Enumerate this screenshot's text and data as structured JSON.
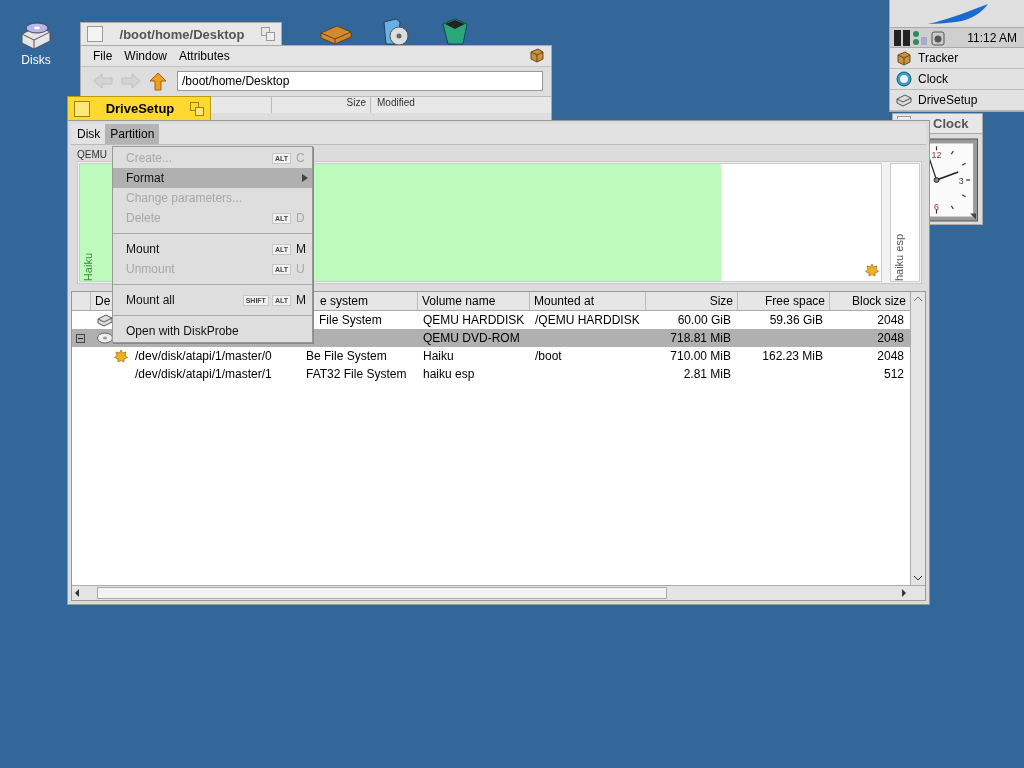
{
  "desktop_icons": [
    {
      "label": "Disks"
    }
  ],
  "tracker_window": {
    "title": "/boot/home/Desktop",
    "menu": [
      "File",
      "Window",
      "Attributes"
    ],
    "path": "/boot/home/Desktop",
    "columns": [
      "Size",
      "Modified"
    ]
  },
  "deskbar": {
    "time": "11:12 AM",
    "apps": [
      {
        "label": "Tracker"
      },
      {
        "label": "Clock"
      },
      {
        "label": "DriveSetup"
      }
    ]
  },
  "clock_window": {
    "title": "Clock",
    "numerals": [
      "12",
      "3",
      "6"
    ]
  },
  "drivesetup_window": {
    "title": "DriveSetup",
    "menu": [
      {
        "label": "Disk",
        "selected": false
      },
      {
        "label": "Partition",
        "selected": true
      }
    ],
    "disk_label": "QEMU",
    "partitions": [
      {
        "name": "Haiku",
        "level": 0.8,
        "boot": true
      },
      {
        "name": "haiku esp",
        "boot": false
      }
    ],
    "columns": [
      "De",
      "e system",
      "Volume name",
      "Mounted at",
      "Size",
      "Free space",
      "Block size"
    ],
    "rows": [
      {
        "kind": "disk",
        "selected": false,
        "cells": [
          "",
          "File System",
          "QEMU HARDDISK",
          "/QEMU HARDDISK",
          "60.00 GiB",
          "59.36 GiB",
          "2048"
        ]
      },
      {
        "kind": "cd",
        "selected": true,
        "expanded": true,
        "cells": [
          "",
          "",
          "QEMU DVD-ROM",
          "",
          "718.81 MiB",
          "",
          "2048"
        ],
        "children": [
          {
            "kind": "partition",
            "boot": true,
            "selected": false,
            "cells": [
              "/dev/disk/atapi/1/master/0",
              "Be File System",
              "Haiku",
              "/boot",
              "710.00 MiB",
              "162.23 MiB",
              "2048"
            ]
          },
          {
            "kind": "partition",
            "boot": false,
            "selected": false,
            "cells": [
              "/dev/disk/atapi/1/master/1",
              "FAT32 File System",
              "haiku esp",
              "",
              "2.81 MiB",
              "",
              "512"
            ]
          }
        ]
      }
    ]
  },
  "partition_menu": [
    {
      "kind": "item",
      "label": "Create...",
      "disabled": true,
      "selected": false,
      "modifiers": [
        "ALT"
      ],
      "key": "C"
    },
    {
      "kind": "item",
      "label": "Format",
      "disabled": false,
      "selected": true,
      "submenu": true
    },
    {
      "kind": "item",
      "label": "Change parameters...",
      "disabled": true,
      "selected": false
    },
    {
      "kind": "item",
      "label": "Delete",
      "disabled": true,
      "selected": false,
      "modifiers": [
        "ALT"
      ],
      "key": "D"
    },
    {
      "kind": "separator"
    },
    {
      "kind": "item",
      "label": "Mount",
      "disabled": false,
      "selected": false,
      "modifiers": [
        "ALT"
      ],
      "key": "M"
    },
    {
      "kind": "item",
      "label": "Unmount",
      "disabled": true,
      "selected": false,
      "modifiers": [
        "ALT"
      ],
      "key": "U"
    },
    {
      "kind": "separator"
    },
    {
      "kind": "item",
      "label": "Mount all",
      "disabled": false,
      "selected": false,
      "modifiers": [
        "SHIFT",
        "ALT"
      ],
      "key": "M"
    },
    {
      "kind": "separator"
    },
    {
      "kind": "item",
      "label": "Open with DiskProbe",
      "disabled": false,
      "selected": false
    }
  ]
}
